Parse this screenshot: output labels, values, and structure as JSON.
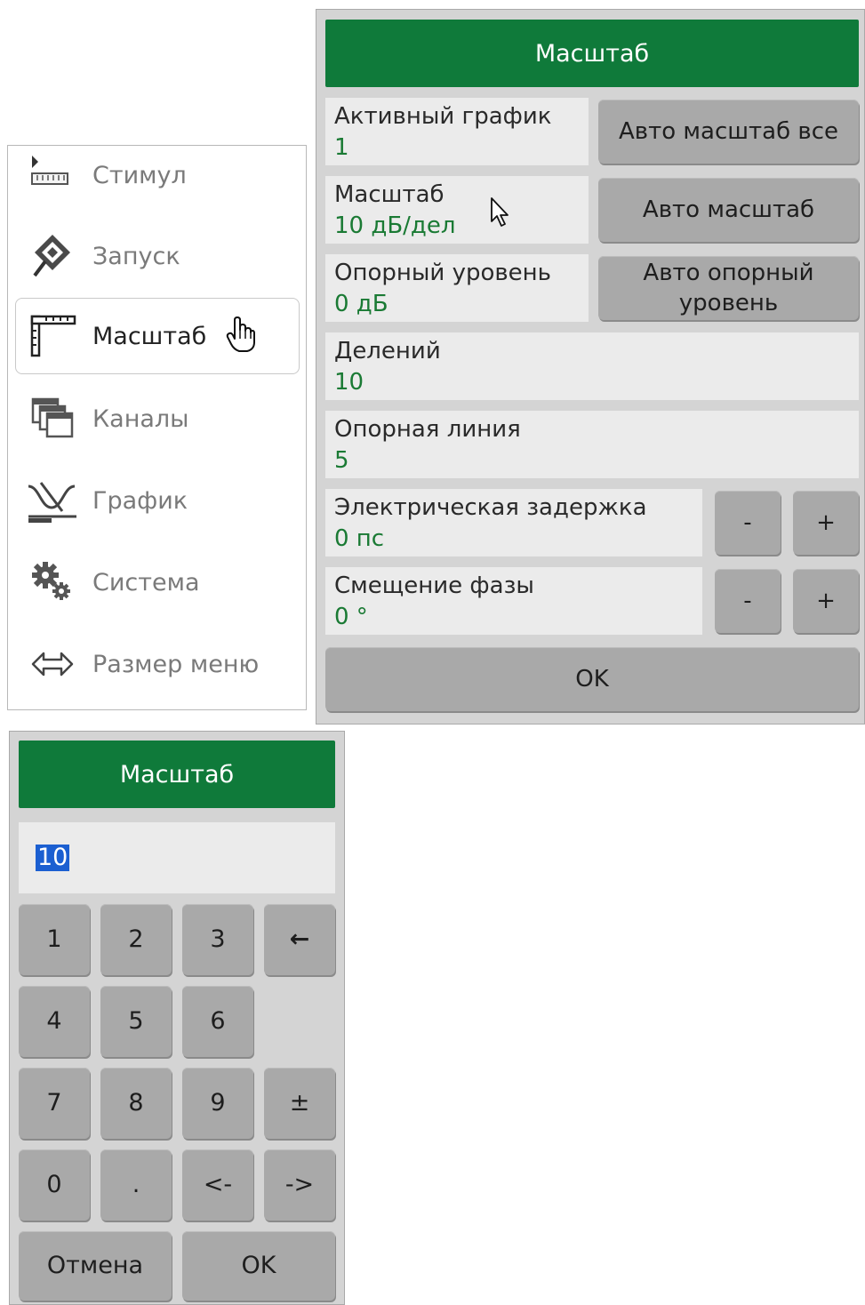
{
  "side_menu": {
    "items": [
      {
        "label": "Стимул",
        "icon": "stimulus-ruler-icon"
      },
      {
        "label": "Запуск",
        "icon": "trigger-diamond-icon"
      },
      {
        "label": "Масштаб",
        "icon": "scale-ruler-icon"
      },
      {
        "label": "Каналы",
        "icon": "channels-windows-icon"
      },
      {
        "label": "График",
        "icon": "trace-graph-icon"
      },
      {
        "label": "Система",
        "icon": "system-gears-icon"
      },
      {
        "label": "Размер меню",
        "icon": "menu-size-arrows-icon"
      }
    ],
    "active_item": "Масштаб"
  },
  "scale_panel": {
    "title": "Масштаб",
    "active_trace": {
      "label": "Активный график",
      "value": "1"
    },
    "auto_scale_all": "Авто масштаб все",
    "scale": {
      "label": "Масштаб",
      "value": "10 дБ/дел"
    },
    "auto_scale": "Авто масштаб",
    "ref_level": {
      "label": "Опорный уровень",
      "value": "0 дБ"
    },
    "auto_ref_level": "Авто опорный уровень",
    "divisions": {
      "label": "Делений",
      "value": "10"
    },
    "ref_position": {
      "label": "Опорная линия",
      "value": "5"
    },
    "electrical_delay": {
      "label": "Электрическая задержка",
      "value": "0 пс"
    },
    "phase_offset": {
      "label": "Смещение фазы",
      "value": "0 °"
    },
    "minus_label": "-",
    "plus_label": "+",
    "ok_label": "OK"
  },
  "keypad_panel": {
    "title": "Масштаб",
    "entry_value": "10",
    "keys": {
      "k1": "1",
      "k2": "2",
      "k3": "3",
      "backspace": "←",
      "k4": "4",
      "k5": "5",
      "k6": "6",
      "k7": "7",
      "k8": "8",
      "k9": "9",
      "plusminus": "±",
      "k0": "0",
      "dot": ".",
      "left": "<-",
      "right": "->"
    },
    "cancel_label": "Отмена",
    "ok_label": "OK"
  },
  "colors": {
    "header_green": "#0f7a3a",
    "value_green": "#1a7a34",
    "button_gray": "#a9a9a9",
    "panel_gray": "#d4d4d4",
    "field_gray": "#ebebeb",
    "selection_blue": "#1b5fd1"
  }
}
